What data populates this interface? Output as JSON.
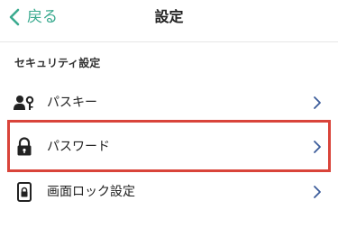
{
  "nav": {
    "back_label": "戻る",
    "title": "設定",
    "back_icon": "chevron-left-icon"
  },
  "section": {
    "header": "セキュリティ設定"
  },
  "items": [
    {
      "label": "パスキー",
      "icon": "person-key-icon"
    },
    {
      "label": "パスワード",
      "icon": "lock-icon"
    },
    {
      "label": "画面ロック設定",
      "icon": "phone-lock-icon"
    }
  ],
  "colors": {
    "accent": "#3aaa8f",
    "highlight": "#d9443a",
    "chevron": "#3b5b9a"
  }
}
